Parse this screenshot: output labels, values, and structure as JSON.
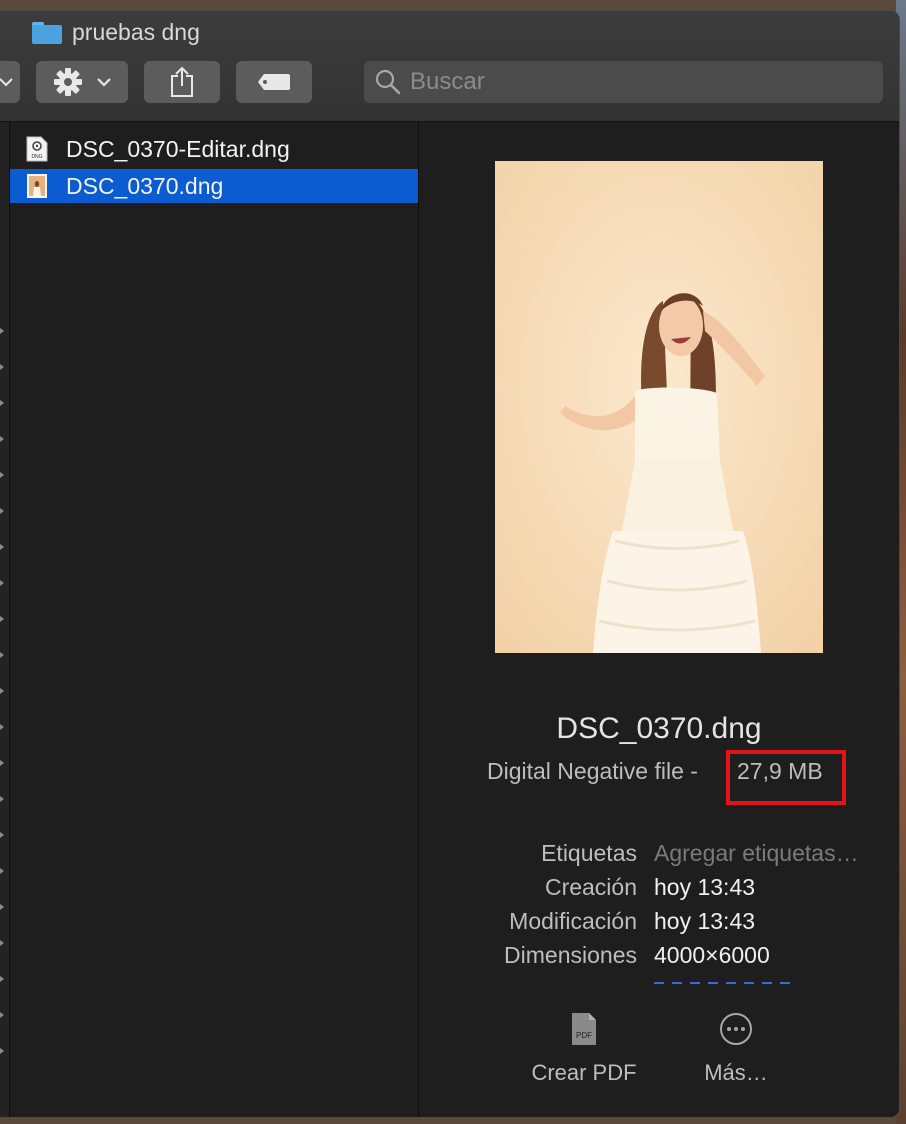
{
  "window": {
    "title": "pruebas dng"
  },
  "toolbar": {
    "action_icon": "gear-icon",
    "share_icon": "share-icon",
    "tag_icon": "tag-icon",
    "search_placeholder": "Buscar"
  },
  "files": [
    {
      "name": "DSC_0370-Editar.dng",
      "icon": "dng-document-icon",
      "selected": false
    },
    {
      "name": "DSC_0370.dng",
      "icon": "image-thumbnail-icon",
      "selected": true
    }
  ],
  "preview": {
    "filename": "DSC_0370.dng",
    "kind": "Digital Negative file -",
    "size": "27,9 MB",
    "highlight_color": "#e3131a",
    "metadata": [
      {
        "key": "Etiquetas",
        "value": "Agregar etiquetas…",
        "placeholder": true
      },
      {
        "key": "Creación",
        "value": "hoy 13:43",
        "placeholder": false
      },
      {
        "key": "Modificación",
        "value": "hoy 13:43",
        "placeholder": false
      },
      {
        "key": "Dimensiones",
        "value": "4000×6000",
        "placeholder": false
      }
    ],
    "actions": [
      {
        "label": "Crear PDF",
        "icon": "pdf-icon"
      },
      {
        "label": "Más…",
        "icon": "more-icon"
      }
    ]
  },
  "colors": {
    "selection": "#0a5cd0",
    "window_bg": "#1e1e1e",
    "toolbar_button": "#5c5c5c"
  }
}
